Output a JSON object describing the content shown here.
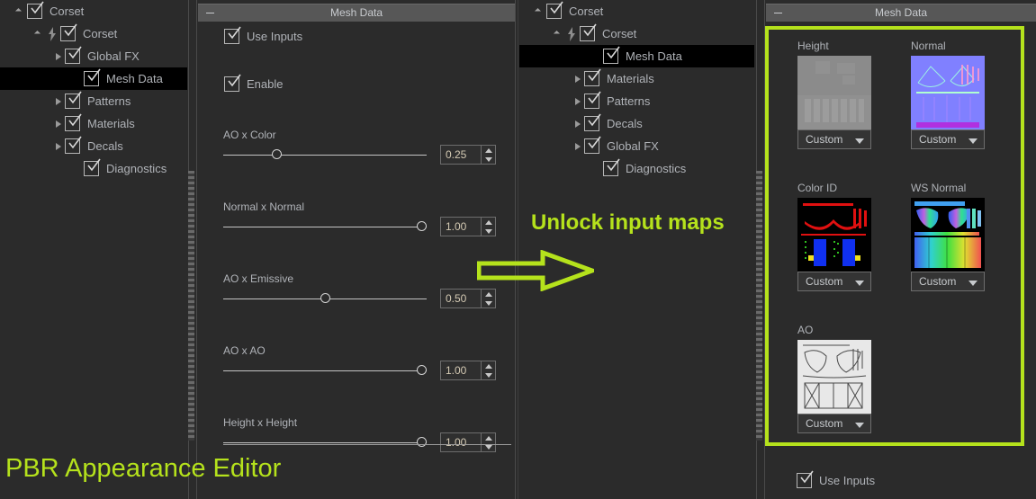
{
  "theme": {
    "bg": "#2b2b2b",
    "panel_header_bg": "#575757",
    "accent_green": "#b5e21c",
    "text": "#b0b3b8",
    "selected_row_bg": "#000000"
  },
  "left_tree": {
    "name": "scene-outliner",
    "items": [
      {
        "label": "Corset",
        "depth": 0,
        "toggle": "expanded",
        "bolt": false,
        "checked": true,
        "selected": false
      },
      {
        "label": "Corset",
        "depth": 1,
        "toggle": "expanded",
        "bolt": true,
        "checked": true,
        "selected": false
      },
      {
        "label": "Global FX",
        "depth": 2,
        "toggle": "collapsed",
        "bolt": false,
        "checked": true,
        "selected": false
      },
      {
        "label": "Mesh Data",
        "depth": 3,
        "toggle": "none",
        "bolt": false,
        "checked": true,
        "selected": true
      },
      {
        "label": "Patterns",
        "depth": 2,
        "toggle": "collapsed",
        "bolt": false,
        "checked": true,
        "selected": false
      },
      {
        "label": "Materials",
        "depth": 2,
        "toggle": "collapsed",
        "bolt": false,
        "checked": true,
        "selected": false
      },
      {
        "label": "Decals",
        "depth": 2,
        "toggle": "collapsed",
        "bolt": false,
        "checked": true,
        "selected": false
      },
      {
        "label": "Diagnostics",
        "depth": 3,
        "toggle": "none",
        "bolt": false,
        "checked": true,
        "selected": false
      }
    ]
  },
  "properties_panel": {
    "title": "Mesh Data",
    "collapse_icon": "minus-icon",
    "checkboxes": [
      {
        "label": "Use Inputs",
        "checked": true
      },
      {
        "label": "Enable",
        "checked": true
      }
    ],
    "sliders": [
      {
        "label": "AO x Color",
        "value": "0.25",
        "fraction": 0.25
      },
      {
        "label": "Normal x Normal",
        "value": "1.00",
        "fraction": 1.0
      },
      {
        "label": "AO x Emissive",
        "value": "0.50",
        "fraction": 0.5
      },
      {
        "label": "AO x AO",
        "value": "1.00",
        "fraction": 1.0
      },
      {
        "label": "Height x Height",
        "value": "1.00",
        "fraction": 1.0
      }
    ]
  },
  "right_tree": {
    "name": "scene-outliner-after",
    "items": [
      {
        "label": "Corset",
        "depth": 0,
        "toggle": "expanded",
        "bolt": false,
        "checked": true,
        "selected": false
      },
      {
        "label": "Corset",
        "depth": 1,
        "toggle": "expanded",
        "bolt": true,
        "checked": true,
        "selected": false
      },
      {
        "label": "Mesh Data",
        "depth": 3,
        "toggle": "none",
        "bolt": false,
        "checked": true,
        "selected": true
      },
      {
        "label": "Materials",
        "depth": 2,
        "toggle": "collapsed",
        "bolt": false,
        "checked": true,
        "selected": false
      },
      {
        "label": "Patterns",
        "depth": 2,
        "toggle": "collapsed",
        "bolt": false,
        "checked": true,
        "selected": false
      },
      {
        "label": "Decals",
        "depth": 2,
        "toggle": "collapsed",
        "bolt": false,
        "checked": true,
        "selected": false
      },
      {
        "label": "Global FX",
        "depth": 2,
        "toggle": "collapsed",
        "bolt": false,
        "checked": true,
        "selected": false
      },
      {
        "label": "Diagnostics",
        "depth": 3,
        "toggle": "none",
        "bolt": false,
        "checked": true,
        "selected": false
      }
    ]
  },
  "maps_panel": {
    "title": "Mesh Data",
    "collapse_icon": "minus-icon",
    "maps": [
      {
        "label": "Height",
        "source": "Custom",
        "thumb": "height"
      },
      {
        "label": "Normal",
        "source": "Custom",
        "thumb": "normal"
      },
      {
        "label": "Color ID",
        "source": "Custom",
        "thumb": "colorid"
      },
      {
        "label": "WS Normal",
        "source": "Custom",
        "thumb": "wsnormal"
      },
      {
        "label": "AO",
        "source": "Custom",
        "thumb": "ao"
      }
    ],
    "footer_checkbox": {
      "label": "Use Inputs",
      "checked": true
    }
  },
  "annotations": {
    "arrow_note": "Unlock input maps",
    "caption": "PBR Appearance Editor",
    "arrow_icon": "right-arrow-outline-icon",
    "highlight_icon": "highlight-box"
  }
}
